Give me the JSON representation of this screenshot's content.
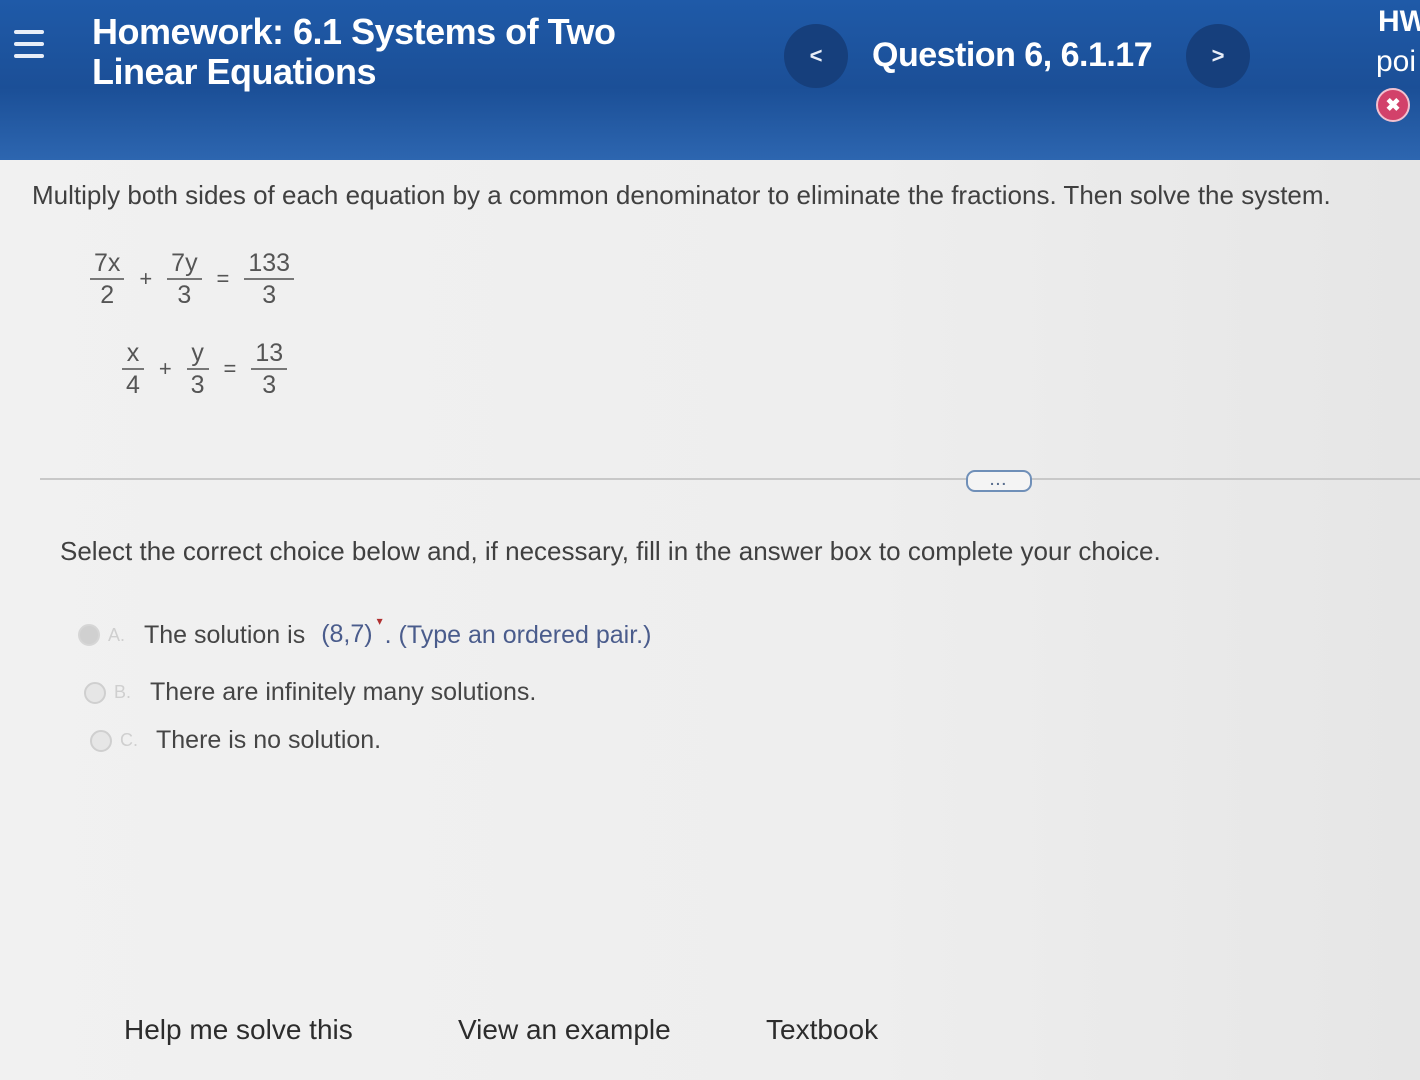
{
  "header": {
    "title_line1": "Homework: 6.1 Systems of Two",
    "title_line2": "Linear Equations",
    "question_label": "Question 6, 6.1.17",
    "prev_glyph": "<",
    "next_glyph": ">",
    "score_label": "HW",
    "points_label": "poi",
    "status_glyph": "✖"
  },
  "problem": {
    "instruction": "Multiply both sides of each equation by a common denominator to eliminate the fractions. Then solve the system.",
    "equations": [
      {
        "t1_num": "7x",
        "t1_den": "2",
        "op": "+",
        "t2_num": "7y",
        "t2_den": "3",
        "eq": "=",
        "rhs_num": "133",
        "rhs_den": "3"
      },
      {
        "t1_num": "x",
        "t1_den": "4",
        "op": "+",
        "t2_num": "y",
        "t2_den": "3",
        "eq": "=",
        "rhs_num": "13",
        "rhs_den": "3"
      }
    ],
    "more_label": "..."
  },
  "answer": {
    "prompt": "Select the correct choice below and, if necessary, fill in the answer box to complete your choice.",
    "choices": [
      {
        "letter": "A.",
        "pre": "The solution is",
        "value": "(8,7)",
        "post": ". (Type an ordered pair.)",
        "selected": true
      },
      {
        "letter": "B.",
        "text": "There are infinitely many solutions."
      },
      {
        "letter": "C.",
        "text": "There is no solution."
      }
    ]
  },
  "footer": {
    "help": "Help me solve this",
    "example": "View an example",
    "textbook": "Textbook"
  }
}
